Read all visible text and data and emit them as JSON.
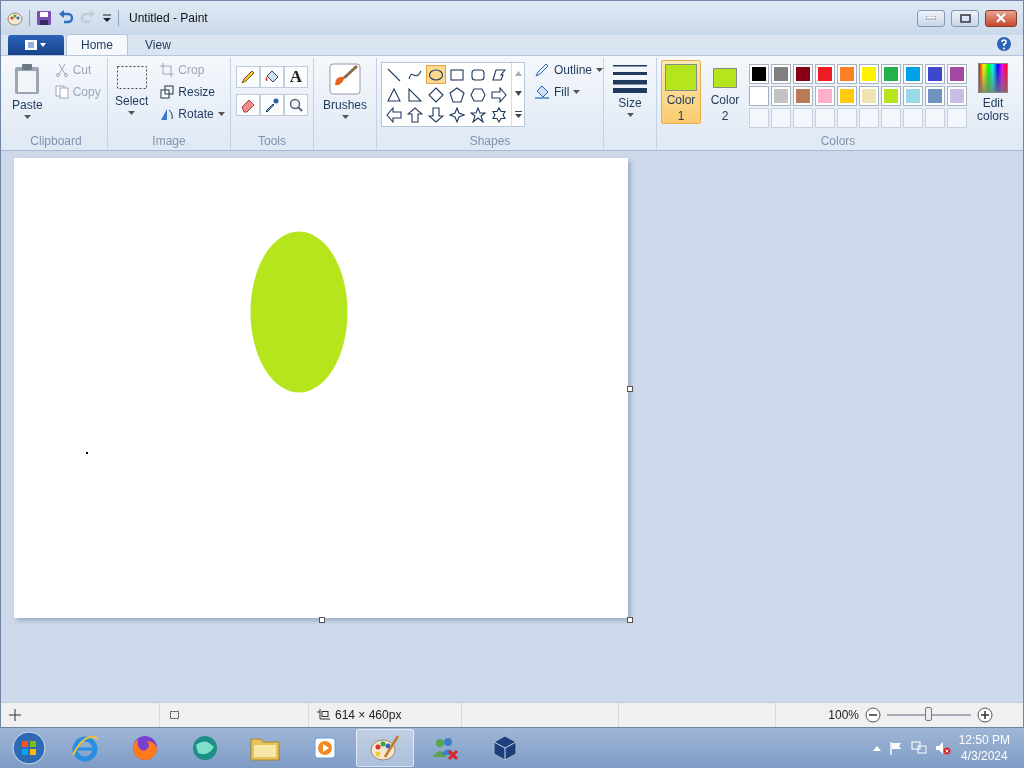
{
  "window": {
    "title": "Untitled - Paint"
  },
  "tabs": [
    {
      "label": "Home",
      "selected": true
    },
    {
      "label": "View",
      "selected": false
    }
  ],
  "clipboard": {
    "label": "Clipboard",
    "paste": "Paste",
    "items": [
      {
        "kind": "cut",
        "label": "Cut",
        "disabled": true
      },
      {
        "kind": "copy",
        "label": "Copy",
        "disabled": true
      }
    ]
  },
  "image": {
    "label": "Image",
    "select": "Select",
    "items": [
      {
        "kind": "crop",
        "label": "Crop",
        "disabled": true
      },
      {
        "kind": "resize",
        "label": "Resize",
        "disabled": false
      },
      {
        "kind": "rotate",
        "label": "Rotate",
        "disabled": false
      }
    ]
  },
  "tools": {
    "label": "Tools",
    "items": [
      {
        "kind": "pencil"
      },
      {
        "kind": "fill"
      },
      {
        "kind": "text",
        "glyph": "A"
      },
      {
        "kind": "eraser"
      },
      {
        "kind": "picker"
      },
      {
        "kind": "magnifier"
      }
    ]
  },
  "brushes": {
    "label": "Brushes"
  },
  "shapes": {
    "label": "Shapes",
    "outline": "Outline",
    "fill": "Fill",
    "items": [
      {
        "kind": "line",
        "selected": false
      },
      {
        "kind": "curve",
        "selected": false
      },
      {
        "kind": "oval",
        "selected": true
      },
      {
        "kind": "rect",
        "selected": false
      },
      {
        "kind": "roundrect",
        "selected": false
      },
      {
        "kind": "polygon",
        "selected": false
      },
      {
        "kind": "triangle",
        "selected": false
      },
      {
        "kind": "rtriangle",
        "selected": false
      },
      {
        "kind": "diamond",
        "selected": false
      },
      {
        "kind": "pentagon",
        "selected": false
      },
      {
        "kind": "hexagon",
        "selected": false
      },
      {
        "kind": "arrow-right",
        "selected": false
      },
      {
        "kind": "arrow-left",
        "selected": false
      },
      {
        "kind": "arrow-up",
        "selected": false
      },
      {
        "kind": "arrow-down",
        "selected": false
      },
      {
        "kind": "star4",
        "selected": false
      },
      {
        "kind": "star5",
        "selected": false
      },
      {
        "kind": "star6",
        "selected": false
      }
    ]
  },
  "size": {
    "label": "Size"
  },
  "colors": {
    "label": "Colors",
    "edit": "Edit colors",
    "slots": [
      {
        "label": "Color",
        "number": "1",
        "color": "#b5e61d",
        "selected": true
      },
      {
        "label": "Color",
        "number": "2",
        "color": "#b5e61d",
        "selected": false
      }
    ],
    "palette": [
      {
        "color": "#000000"
      },
      {
        "color": "#7f7f7f"
      },
      {
        "color": "#880015"
      },
      {
        "color": "#ed1c24"
      },
      {
        "color": "#ff7f27"
      },
      {
        "color": "#fff200"
      },
      {
        "color": "#22b14c"
      },
      {
        "color": "#00a2e8"
      },
      {
        "color": "#3f48cc"
      },
      {
        "color": "#a349a4"
      },
      {
        "color": "#ffffff"
      },
      {
        "color": "#c3c3c3"
      },
      {
        "color": "#b97a57"
      },
      {
        "color": "#ffaec9"
      },
      {
        "color": "#ffc90e"
      },
      {
        "color": "#efe4b0"
      },
      {
        "color": "#b5e61d"
      },
      {
        "color": "#99d9ea"
      },
      {
        "color": "#7092be"
      },
      {
        "color": "#c8bfe7"
      }
    ]
  },
  "canvas": {
    "drawing": {
      "kind": "ellipse",
      "color": "#b5e61d"
    }
  },
  "status_bar": {
    "dimensions": "614 × 460px",
    "zoom": "100%",
    "zoom_slider": {
      "level": 0.5
    }
  },
  "taskbar": {
    "apps": [
      {
        "kind": "browser-e",
        "active": false
      },
      {
        "kind": "fox",
        "active": false
      },
      {
        "kind": "globe",
        "active": false
      },
      {
        "kind": "folder",
        "active": false
      },
      {
        "kind": "media",
        "active": false
      },
      {
        "kind": "palette",
        "active": true
      },
      {
        "kind": "people",
        "active": false
      },
      {
        "kind": "cube",
        "active": false
      }
    ],
    "time": "12:50 PM",
    "date": "4/3/2024"
  }
}
